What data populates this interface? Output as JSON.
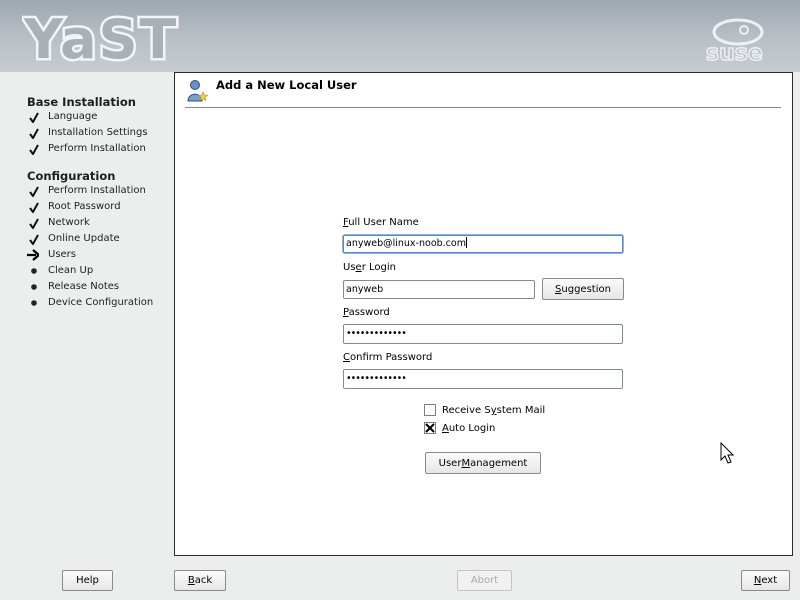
{
  "header": {
    "logo_text": "YaST",
    "brand_text": "suse"
  },
  "sidebar": {
    "sections": [
      {
        "title": "Base Installation",
        "items": [
          {
            "label": "Language",
            "state": "done"
          },
          {
            "label": "Installation Settings",
            "state": "done"
          },
          {
            "label": "Perform Installation",
            "state": "done"
          }
        ]
      },
      {
        "title": "Configuration",
        "items": [
          {
            "label": "Perform Installation",
            "state": "done"
          },
          {
            "label": "Root Password",
            "state": "done"
          },
          {
            "label": "Network",
            "state": "done"
          },
          {
            "label": "Online Update",
            "state": "done"
          },
          {
            "label": "Users",
            "state": "current"
          },
          {
            "label": "Clean Up",
            "state": "pending"
          },
          {
            "label": "Release Notes",
            "state": "pending"
          },
          {
            "label": "Device Configuration",
            "state": "pending"
          }
        ]
      }
    ]
  },
  "panel": {
    "title": "Add a New Local User",
    "icon": "user-add-icon",
    "full_name": {
      "label_pre": "",
      "label_key": "F",
      "label_post": "ull User Name",
      "value": "anyweb@linux-noob.com"
    },
    "login": {
      "label_pre": "Us",
      "label_key": "e",
      "label_post": "r Login",
      "value": "anyweb"
    },
    "suggestion_button": {
      "label_pre": "",
      "label_key": "S",
      "label_post": "uggestion"
    },
    "password": {
      "label_pre": "",
      "label_key": "P",
      "label_post": "assword",
      "value": "•••••••••••••"
    },
    "confirm": {
      "label_pre": "",
      "label_key": "C",
      "label_post": "onfirm Password",
      "value": "•••••••••••••"
    },
    "receive_mail": {
      "label_pre": "Receive S",
      "label_key": "y",
      "label_post": "stem Mail",
      "checked": false
    },
    "auto_login": {
      "label_pre": "",
      "label_key": "A",
      "label_post": "uto Login",
      "checked": true
    },
    "user_mgmt_button": {
      "label_pre": "User ",
      "label_key": "M",
      "label_post": "anagement"
    }
  },
  "buttons": {
    "help": {
      "label": "Help"
    },
    "back": {
      "label_pre": "",
      "label_key": "B",
      "label_post": "ack"
    },
    "abort": {
      "label": "Abort"
    },
    "next": {
      "label_pre": "",
      "label_key": "N",
      "label_post": "ext"
    }
  },
  "colors": {
    "header": "#b9c0c6",
    "background": "#eceeee",
    "panel": "#ffffff",
    "focus": "#5a88c6"
  }
}
